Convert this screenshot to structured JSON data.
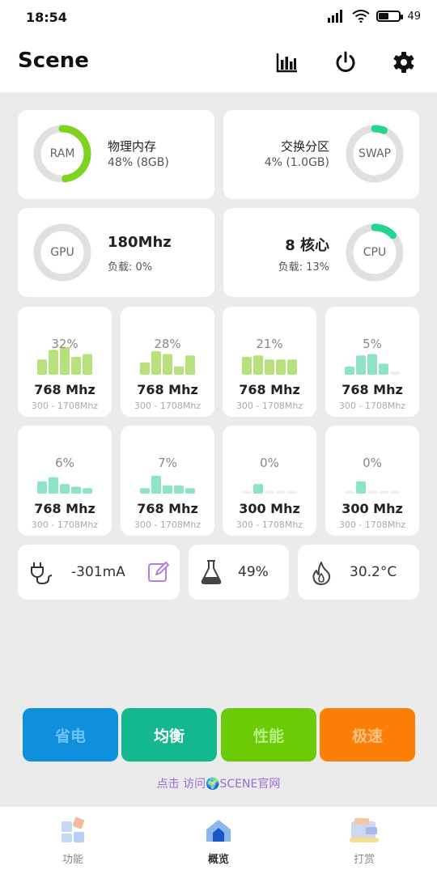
{
  "status_bar": {
    "time": "18:54",
    "battery_text": "49"
  },
  "app": {
    "title": "Scene"
  },
  "header_icons": [
    "bar-chart-icon",
    "power-icon",
    "settings-gear-icon"
  ],
  "memory": {
    "ram": {
      "label": "RAM",
      "title": "物理内存",
      "detail": "48% (8GB)",
      "percent": 48
    },
    "swap": {
      "label": "SWAP",
      "title": "交换分区",
      "detail": "4% (1.0GB)",
      "percent": 4
    }
  },
  "gpu": {
    "label": "GPU",
    "freq": "180Mhz",
    "load": "负载: 0%",
    "percent": 0
  },
  "cpu": {
    "label": "CPU",
    "cores": "8 核心",
    "load": "负载: 13%",
    "percent": 13
  },
  "cores": [
    {
      "pct": "32%",
      "freq": "768 Mhz",
      "range": "300 - 1708Mhz",
      "bars": [
        0.55,
        0.9,
        1.0,
        0.65,
        0.75
      ],
      "color": "#b7e17a"
    },
    {
      "pct": "28%",
      "freq": "768 Mhz",
      "range": "300 - 1708Mhz",
      "bars": [
        0.45,
        0.85,
        0.75,
        0.3,
        0.7
      ],
      "color": "#b7e17a"
    },
    {
      "pct": "21%",
      "freq": "768 Mhz",
      "range": "300 - 1708Mhz",
      "bars": [
        0.65,
        0.7,
        0.55,
        0.55,
        0.55
      ],
      "color": "#b7e17a"
    },
    {
      "pct": "5%",
      "freq": "768 Mhz",
      "range": "300 - 1708Mhz",
      "bars": [
        0.3,
        0.7,
        0.75,
        0.4,
        0.12
      ],
      "color": "#8de3c6"
    },
    {
      "pct": "6%",
      "freq": "768 Mhz",
      "range": "300 - 1708Mhz",
      "bars": [
        0.45,
        0.6,
        0.35,
        0.25,
        0.2
      ],
      "color": "#8de3c6"
    },
    {
      "pct": "7%",
      "freq": "768 Mhz",
      "range": "300 - 1708Mhz",
      "bars": [
        0.2,
        0.65,
        0.3,
        0.3,
        0.2
      ],
      "color": "#8de3c6"
    },
    {
      "pct": "0%",
      "freq": "300 Mhz",
      "range": "300 - 1708Mhz",
      "bars": [
        0.1,
        0.35,
        0.1,
        0.1,
        0.1
      ],
      "color": "#8de3c6"
    },
    {
      "pct": "0%",
      "freq": "300 Mhz",
      "range": "300 - 1708Mhz",
      "bars": [
        0.1,
        0.45,
        0.1,
        0.1,
        0.1
      ],
      "color": "#8de3c6"
    }
  ],
  "info": {
    "current": "-301mA",
    "battery_level": "49%",
    "temperature": "30.2°C"
  },
  "modes": [
    {
      "label": "省电",
      "bg": "#0f8fdc",
      "fg": "#6cc4f7"
    },
    {
      "label": "均衡",
      "bg": "#13b88f",
      "fg": "#ffffff"
    },
    {
      "label": "性能",
      "bg": "#6acb06",
      "fg": "#b9ee82"
    },
    {
      "label": "极速",
      "bg": "#fb7f07",
      "fg": "#ffc088"
    }
  ],
  "website_link": "点击 访问🌍SCENE官网",
  "bottom_nav": [
    {
      "label": "功能",
      "icon": "features-icon"
    },
    {
      "label": "概览",
      "icon": "home-icon"
    },
    {
      "label": "打赏",
      "icon": "donate-wallet-icon"
    }
  ],
  "colors": {
    "ram_ring": "#7ed321",
    "accent_green": "#21d68f",
    "ring_track": "#e0e0e0"
  }
}
